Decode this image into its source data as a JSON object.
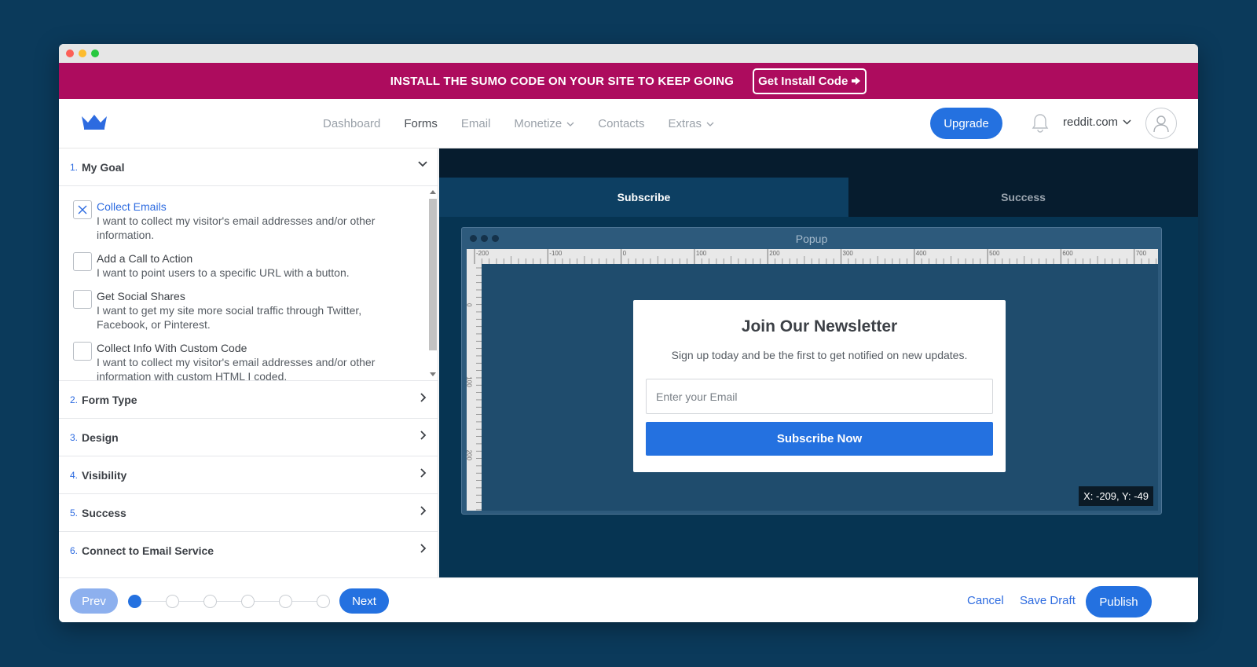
{
  "window": {
    "traffic_lights": [
      "#fc5f57",
      "#fdbc2e",
      "#28c840"
    ]
  },
  "banner": {
    "text": "INSTALL THE SUMO CODE ON YOUR SITE TO KEEP GOING",
    "button_label": "Get Install Code"
  },
  "nav": {
    "links": [
      {
        "label": "Dashboard"
      },
      {
        "label": "Forms"
      },
      {
        "label": "Email"
      },
      {
        "label": "Monetize"
      },
      {
        "label": "Contacts"
      },
      {
        "label": "Extras"
      }
    ],
    "upgrade_label": "Upgrade",
    "site_name": "reddit.com"
  },
  "sidebar": {
    "sections": [
      {
        "num": "1.",
        "label": "My Goal"
      },
      {
        "num": "2.",
        "label": "Form Type"
      },
      {
        "num": "3.",
        "label": "Design"
      },
      {
        "num": "4.",
        "label": "Visibility"
      },
      {
        "num": "5.",
        "label": "Success"
      },
      {
        "num": "6.",
        "label": "Connect to Email Service"
      }
    ],
    "goals": [
      {
        "title": "Collect Emails",
        "desc": "I want to collect my visitor's email addresses and/or other information."
      },
      {
        "title": "Add a Call to Action",
        "desc": "I want to point users to a specific URL with a button."
      },
      {
        "title": "Get Social Shares",
        "desc": "I want to get my site more social traffic through Twitter, Facebook, or Pinterest."
      },
      {
        "title": "Collect Info With Custom Code",
        "desc": "I want to collect my visitor's email addresses and/or other information with custom HTML I coded."
      }
    ]
  },
  "editor": {
    "tabs": [
      {
        "label": "Subscribe"
      },
      {
        "label": "Success"
      }
    ],
    "frame_label": "Popup",
    "ruler_top_labels": [
      "-200",
      "-100",
      "0",
      "100",
      "200",
      "300",
      "400",
      "500",
      "600",
      "700"
    ],
    "ruler_left_labels": [
      "0",
      "100",
      "200"
    ],
    "coords": "X: -209, Y: -49"
  },
  "popup": {
    "title": "Join Our Newsletter",
    "subtitle": "Sign up today and be the first to get notified on new updates.",
    "email_placeholder": "Enter your Email",
    "button_label": "Subscribe Now"
  },
  "footer": {
    "prev_label": "Prev",
    "next_label": "Next",
    "cancel_label": "Cancel",
    "save_draft_label": "Save Draft",
    "publish_label": "Publish"
  },
  "colors": {
    "accent": "#2471e0",
    "banner": "#ad0c5e",
    "background": "#0b3a5b"
  }
}
